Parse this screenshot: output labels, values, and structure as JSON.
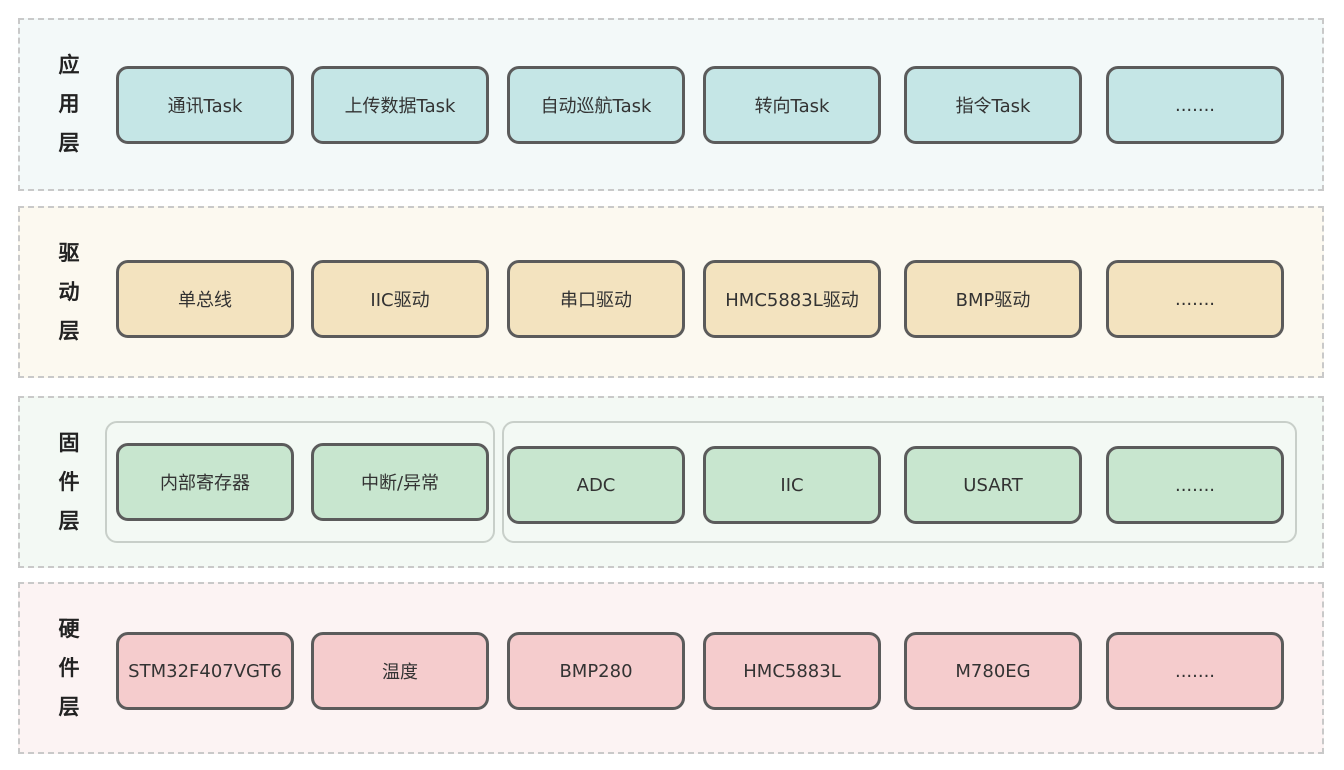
{
  "layers": [
    {
      "id": "app",
      "label_chars": [
        "应",
        "用",
        "层"
      ],
      "background": "#f3f9f9",
      "box_color": "#c5e6e6",
      "boxes": [
        "通讯Task",
        "上传数据Task",
        "自动巡航Task",
        "转向Task",
        "指令Task",
        "......."
      ]
    },
    {
      "id": "driver",
      "label_chars": [
        "驱",
        "动",
        "层"
      ],
      "background": "#fcf9f0",
      "box_color": "#f3e3bf",
      "boxes": [
        "单总线",
        "IIC驱动",
        "串口驱动",
        "HMC5883L驱动",
        "BMP驱动",
        "......."
      ]
    },
    {
      "id": "firmware",
      "label_chars": [
        "固",
        "件",
        "层"
      ],
      "background": "#f3f9f4",
      "box_color": "#c8e6cf",
      "boxes": [
        "内部寄存器",
        "中断/异常",
        "ADC",
        "IIC",
        "USART",
        "......."
      ]
    },
    {
      "id": "hardware",
      "label_chars": [
        "硬",
        "件",
        "层"
      ],
      "background": "#fcf3f3",
      "box_color": "#f5cccd",
      "boxes": [
        "STM32F407VGT6",
        "温度",
        "BMP280",
        "HMC5883L",
        "M780EG",
        "......."
      ]
    }
  ]
}
